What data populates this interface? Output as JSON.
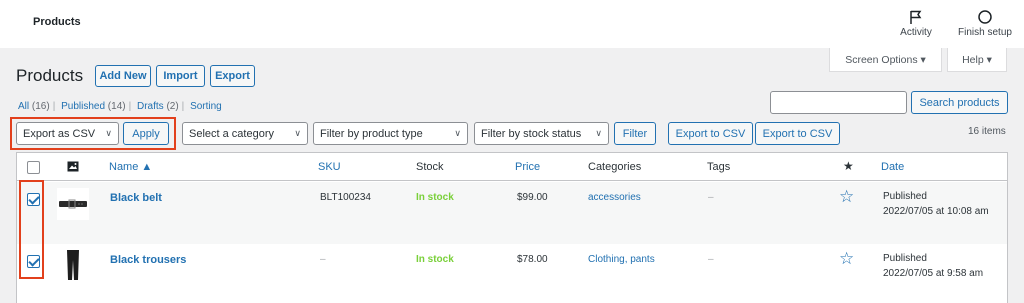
{
  "topbar": {
    "title": "Products",
    "activity_label": "Activity",
    "finish_setup_label": "Finish setup"
  },
  "screen_options": {
    "label": "Screen Options ▾",
    "help_label": "Help ▾"
  },
  "page": {
    "title": "Products",
    "add_new": "Add New",
    "import": "Import",
    "export": "Export"
  },
  "views": {
    "all": "All",
    "all_count": "(16)",
    "published": "Published",
    "published_count": "(14)",
    "drafts": "Drafts",
    "drafts_count": "(2)",
    "sorting": "Sorting",
    "sep": "|"
  },
  "search": {
    "placeholder": "",
    "button": "Search products"
  },
  "tablenav": {
    "bulk_action": "Export as CSV",
    "apply": "Apply",
    "category": "Select a category",
    "product_type": "Filter by product type",
    "stock_status": "Filter by stock status",
    "filter": "Filter",
    "export_csv_1": "Export to CSV",
    "export_csv_2": "Export to CSV",
    "items_count": "16 items"
  },
  "columns": {
    "name": "Name ▲",
    "sku": "SKU",
    "stock": "Stock",
    "price": "Price",
    "categories": "Categories",
    "tags": "Tags",
    "date": "Date"
  },
  "rows": [
    {
      "name": "Black belt",
      "sku": "BLT100234",
      "stock": "In stock",
      "price": "$99.00",
      "categories": "accessories",
      "tags": "–",
      "status": "Published",
      "date": "2022/07/05 at 10:08 am",
      "checked": true
    },
    {
      "name": "Black trousers",
      "sku": "–",
      "stock": "In stock",
      "price": "$78.00",
      "categories": "Clothing, pants",
      "tags": "–",
      "status": "Published",
      "date": "2022/07/05 at 9:58 am",
      "checked": true
    }
  ],
  "colors": {
    "accent": "#2271b1",
    "highlight": "#e2401c",
    "in_stock": "#7ad03a"
  }
}
